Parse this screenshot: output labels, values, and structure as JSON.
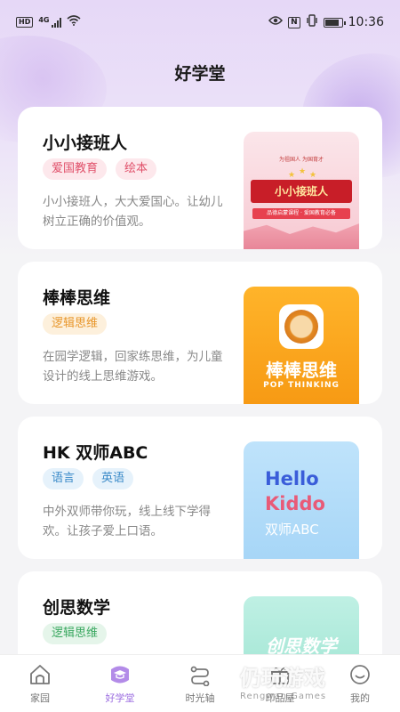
{
  "status_bar": {
    "left_badges": [
      "HD",
      "4G"
    ],
    "time": "10:36",
    "nfc": "N"
  },
  "header": {
    "title": "好学堂"
  },
  "courses": [
    {
      "title": "小小接班人",
      "tags": [
        "爱国教育",
        "绘本"
      ],
      "description": "小小接班人，大大爱国心。让幼儿树立正确的价值观。",
      "thumb": {
        "top_small": "为祖国人 为国育才",
        "banner": "小小接班人",
        "sub": "品德启蒙课程 · 爱国教育必备"
      }
    },
    {
      "title": "棒棒思维",
      "tags": [
        "逻辑思维"
      ],
      "description": "在园学逻辑，回家练思维，为儿童设计的线上思维游戏。",
      "thumb": {
        "big": "棒棒思维",
        "small": "POP THINKING"
      }
    },
    {
      "title": "HK 双师ABC",
      "tags": [
        "语言",
        "英语"
      ],
      "description": "中外双师带你玩，线上线下学得欢。让孩子爱上口语。",
      "thumb": {
        "line1": "Hello",
        "line2": "Kiddo",
        "line3": "双师ABC"
      }
    },
    {
      "title": "创思数学",
      "tags": [
        "逻辑思维"
      ],
      "description": "",
      "thumb": {
        "big": "创思数学"
      }
    }
  ],
  "tabs": [
    {
      "label": "家园",
      "icon": "home-icon"
    },
    {
      "label": "好学堂",
      "icon": "graduation-cap-icon",
      "active": true
    },
    {
      "label": "时光轴",
      "icon": "timeline-icon"
    },
    {
      "label": "印品屋",
      "icon": "gift-icon"
    },
    {
      "label": "我的",
      "icon": "smile-icon"
    }
  ],
  "watermark": {
    "main": "仍玩游戏",
    "sub": "Rengwan Games"
  },
  "colors": {
    "accent": "#9b6ce0",
    "tag_red": "#e0506a",
    "tag_orange": "#e8962a",
    "tag_blue": "#3b8ac8",
    "tag_green": "#3aa860"
  }
}
